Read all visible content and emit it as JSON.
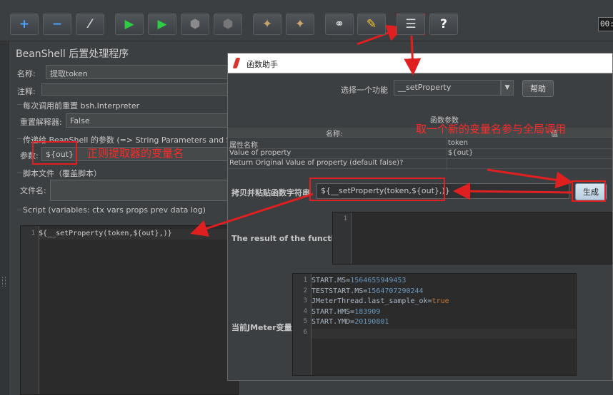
{
  "toolbar": {
    "buttons": [
      {
        "name": "add-icon",
        "glyph": "+",
        "color": "#4aa3ff"
      },
      {
        "name": "remove-icon",
        "glyph": "−",
        "color": "#4aa3ff"
      },
      {
        "name": "toggle-icon",
        "glyph": "⁄",
        "color": "#cfcfcf"
      },
      {
        "name": "start-icon",
        "glyph": "▶",
        "color": "#2ecc40"
      },
      {
        "name": "start-no-pause-icon",
        "glyph": "▶",
        "color": "#2ecc40"
      },
      {
        "name": "stop-icon",
        "glyph": "⬢",
        "color": "#8a8a8a"
      },
      {
        "name": "shutdown-icon",
        "glyph": "⬢",
        "color": "#777777"
      },
      {
        "name": "clear-icon",
        "glyph": "✦",
        "color": "#c9a46b"
      },
      {
        "name": "clear-all-icon",
        "glyph": "✦",
        "color": "#c9a46b"
      },
      {
        "name": "search-icon",
        "glyph": "⚭",
        "color": "#dddddd"
      },
      {
        "name": "reset-search-icon",
        "glyph": "✎",
        "color": "#f2c12e"
      },
      {
        "name": "function-helper-icon",
        "glyph": "☰",
        "color": "#dddddd"
      },
      {
        "name": "help-icon",
        "glyph": "?",
        "color": "#ffffff"
      }
    ],
    "elapsed_time": "00:0"
  },
  "panel": {
    "title": "BeanShell 后置处理程序",
    "name_label": "名称:",
    "name_value": "提取token",
    "comment_label": "注释:",
    "reset_group_title": "每次调用前重置 bsh.Interpreter",
    "reset_label": "重置解释器:",
    "reset_value": "False",
    "params_group_title": "传递给 BeanShell 的参数 (=> String Parameters and Strin",
    "params_label": "参数:",
    "params_value": "${out}",
    "script_file_group_title": "脚本文件（覆盖脚本）",
    "file_label": "文件名:",
    "script_group_title": "Script (variables: ctx vars props prev data log)",
    "script_line_number": "1",
    "script_line": "${__setProperty(token,${out},)}"
  },
  "annotations": {
    "regex_note": "正则提取器的变量名",
    "global_note": "取一个新的变量名参与全局调用"
  },
  "dialog": {
    "title": "函数助手",
    "select_label": "选择一个功能",
    "function_value": "__setProperty",
    "help_button": "帮助",
    "params_title": "函数参数",
    "col_name": "名称:",
    "col_value": "值",
    "rows": [
      {
        "name": "属性名称",
        "value": "token"
      },
      {
        "name": "Value of property",
        "value": "${out}"
      },
      {
        "name": "Return Original Value of property (default false)?",
        "value": ""
      }
    ],
    "copy_label": "拷贝并粘贴函数字符串",
    "function_string": "${__setProperty(token,${out},)}",
    "generate_button": "生成",
    "result_label": "The result of the function is",
    "result_line_number": "1",
    "vars_label": "当前JMeter变量",
    "vars_lines": [
      {
        "n": "1",
        "key": "START.MS=",
        "val": "1564655949453",
        "type": "num"
      },
      {
        "n": "2",
        "key": "TESTSTART.MS=",
        "val": "1564707290244",
        "type": "num"
      },
      {
        "n": "3",
        "key": "JMeterThread.last_sample_ok=",
        "val": "true",
        "type": "kw"
      },
      {
        "n": "4",
        "key": "START.HMS=",
        "val": "183909",
        "type": "num"
      },
      {
        "n": "5",
        "key": "START.YMD=",
        "val": "20190801",
        "type": "num"
      },
      {
        "n": "6",
        "key": "",
        "val": "",
        "type": "num"
      }
    ]
  },
  "colors": {
    "annotation_red": "#ff2a2a",
    "background": "#3c3f41",
    "editor_bg": "#2b2b2b"
  }
}
